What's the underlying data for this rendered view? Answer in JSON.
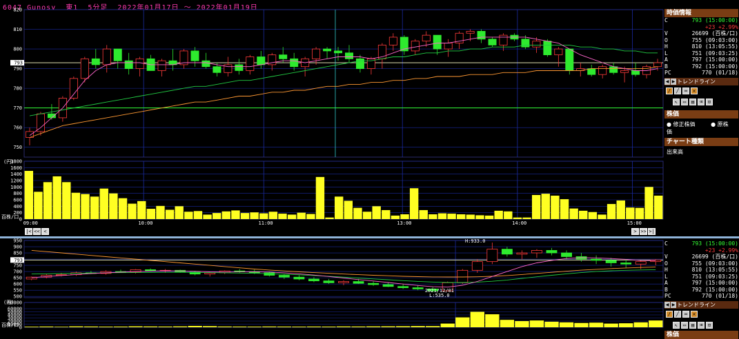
{
  "title": "6047 Gunosy  東1  5分足  2022年01月17日 ～ 2022年01月19日",
  "colors": {
    "up": "#ff3b3b",
    "down": "#2eea2e",
    "volume": "#ffff22",
    "grid": "#1a2aa0",
    "ma_fast": "#ff66cc",
    "ma_mid": "#22cc44",
    "ma_slow": "#ff9933"
  },
  "info": {
    "header": "時価情報",
    "rows": [
      {
        "k": "C",
        "v": "793 (15:00:00)",
        "cls": "green"
      },
      {
        "k": "",
        "v": "+23 +2.99%",
        "cls": "red"
      },
      {
        "k": "V",
        "v": "26699 (百株/口)",
        "cls": ""
      },
      {
        "k": "O",
        "v": "755 (09:03:00)",
        "cls": ""
      },
      {
        "k": "H",
        "v": "810 (13:05:55)",
        "cls": ""
      },
      {
        "k": "L",
        "v": "751 (09:03:25)",
        "cls": ""
      },
      {
        "k": "A",
        "v": "797 (15:00:00)",
        "cls": ""
      },
      {
        "k": "B",
        "v": "792 (15:00:00)",
        "cls": ""
      },
      {
        "k": "PC",
        "v": "770 (01/18)",
        "cls": ""
      }
    ],
    "trendline_label": "トレンドライン",
    "price_header": "株価",
    "radio_adjusted": "修正株価",
    "radio_original": "原株価",
    "chart_type_header": "チャート種類",
    "chart_type_value": "出来高",
    "bottom_header": "株価"
  },
  "chart_data": [
    {
      "type": "candlestick",
      "title": "6047 Gunosy  東1  5分足  2022年01月17日 ～ 2022年01月19日",
      "ylabel": "(円)",
      "yticks": [
        750,
        760,
        770,
        780,
        790,
        800,
        810,
        820
      ],
      "ylim": [
        745,
        820
      ],
      "current_price": 793,
      "prev_close": 770,
      "x_ticks": [
        "09:00",
        "10:00",
        "11:00",
        "13:00",
        "14:00",
        "15:00"
      ],
      "candles": [
        [
          755,
          760,
          751,
          758
        ],
        [
          758,
          768,
          756,
          767
        ],
        [
          767,
          772,
          764,
          765
        ],
        [
          765,
          776,
          763,
          775
        ],
        [
          775,
          786,
          774,
          785
        ],
        [
          785,
          796,
          783,
          795
        ],
        [
          795,
          800,
          790,
          792
        ],
        [
          792,
          802,
          788,
          800
        ],
        [
          800,
          798,
          790,
          794
        ],
        [
          794,
          798,
          787,
          790
        ],
        [
          790,
          796,
          786,
          795
        ],
        [
          795,
          797,
          789,
          789
        ],
        [
          789,
          795,
          786,
          794
        ],
        [
          794,
          800,
          789,
          792
        ],
        [
          792,
          800,
          790,
          799
        ],
        [
          799,
          801,
          791,
          794
        ],
        [
          794,
          798,
          790,
          791
        ],
        [
          791,
          793,
          786,
          788
        ],
        [
          788,
          796,
          786,
          792
        ],
        [
          792,
          795,
          787,
          789
        ],
        [
          789,
          797,
          787,
          796
        ],
        [
          796,
          799,
          790,
          792
        ],
        [
          792,
          798,
          789,
          797
        ],
        [
          797,
          801,
          793,
          795
        ],
        [
          795,
          798,
          789,
          791
        ],
        [
          791,
          796,
          786,
          795
        ],
        [
          795,
          801,
          792,
          800
        ],
        [
          800,
          801,
          795,
          799
        ],
        [
          799,
          801,
          794,
          798
        ],
        [
          798,
          802,
          793,
          795
        ],
        [
          795,
          797,
          788,
          790
        ],
        [
          790,
          796,
          787,
          795
        ],
        [
          795,
          803,
          790,
          802
        ],
        [
          802,
          808,
          799,
          806
        ],
        [
          806,
          807,
          797,
          799
        ],
        [
          799,
          805,
          797,
          804
        ],
        [
          804,
          809,
          801,
          807
        ],
        [
          807,
          806,
          797,
          800
        ],
        [
          800,
          805,
          796,
          803
        ],
        [
          803,
          809,
          800,
          808
        ],
        [
          808,
          810,
          804,
          809
        ],
        [
          809,
          810,
          803,
          805
        ],
        [
          805,
          806,
          801,
          802
        ],
        [
          802,
          808,
          799,
          807
        ],
        [
          807,
          808,
          804,
          805
        ],
        [
          805,
          807,
          800,
          801
        ],
        [
          801,
          806,
          798,
          804
        ],
        [
          804,
          805,
          796,
          797
        ],
        [
          797,
          801,
          791,
          800
        ],
        [
          800,
          800,
          787,
          789
        ],
        [
          789,
          793,
          786,
          790
        ],
        [
          790,
          792,
          786,
          787
        ],
        [
          787,
          792,
          785,
          791
        ],
        [
          791,
          793,
          787,
          788
        ],
        [
          788,
          791,
          783,
          789
        ],
        [
          789,
          793,
          786,
          787
        ],
        [
          787,
          792,
          785,
          791
        ],
        [
          791,
          795,
          789,
          793
        ]
      ],
      "ma_fast": [
        756,
        760,
        765,
        770,
        777,
        784,
        789,
        792,
        793,
        793,
        793,
        792,
        792,
        792,
        793,
        793,
        793,
        792,
        791,
        791,
        791,
        792,
        793,
        794,
        794,
        793,
        794,
        795,
        796,
        796,
        796,
        795,
        796,
        798,
        800,
        801,
        802,
        803,
        803,
        804,
        805,
        806,
        806,
        806,
        806,
        806,
        805,
        804,
        803,
        800,
        797,
        795,
        793,
        791,
        790,
        789,
        789,
        790
      ],
      "ma_mid": [
        766,
        767,
        768,
        769,
        770,
        771,
        772,
        773,
        774,
        775,
        776,
        777,
        778,
        779,
        780,
        781,
        781,
        782,
        783,
        784,
        784,
        785,
        786,
        787,
        788,
        789,
        790,
        791,
        792,
        793,
        794,
        794,
        795,
        796,
        796,
        797,
        798,
        798,
        799,
        799,
        800,
        800,
        801,
        801,
        801,
        802,
        802,
        802,
        802,
        802,
        801,
        801,
        800,
        800,
        799,
        799,
        798,
        798
      ],
      "ma_slow": [
        755,
        757,
        759,
        761,
        762,
        763,
        764,
        765,
        766,
        767,
        768,
        769,
        770,
        771,
        772,
        773,
        773,
        774,
        775,
        776,
        776,
        777,
        778,
        778,
        779,
        779,
        780,
        781,
        781,
        782,
        782,
        783,
        783,
        784,
        784,
        785,
        785,
        786,
        786,
        786,
        787,
        787,
        787,
        788,
        788,
        788,
        789,
        789,
        789,
        789,
        789,
        790,
        790,
        790,
        790,
        790,
        790,
        791
      ]
    },
    {
      "type": "bar",
      "ylabel": "百株/口",
      "yticks": [
        0,
        200,
        400,
        600,
        800,
        1000,
        1200,
        1400,
        1600,
        1800
      ],
      "ylim": [
        0,
        1800
      ],
      "values": [
        1500,
        850,
        1150,
        1330,
        1150,
        820,
        780,
        700,
        950,
        800,
        650,
        480,
        560,
        320,
        410,
        290,
        400,
        230,
        250,
        140,
        190,
        240,
        270,
        190,
        210,
        180,
        230,
        170,
        140,
        200,
        160,
        1310,
        50,
        700,
        570,
        350,
        230,
        400,
        280,
        110,
        150,
        960,
        280,
        150,
        180,
        170,
        150,
        140,
        120,
        110,
        260,
        240,
        50,
        50,
        750,
        790,
        730,
        620,
        330,
        260,
        220,
        140,
        470,
        580,
        360,
        350,
        1000,
        730
      ]
    },
    {
      "type": "candlestick",
      "ylabel": "(円)",
      "yticks": [
        500,
        550,
        600,
        650,
        700,
        750,
        800,
        850,
        900,
        950
      ],
      "ylim": [
        490,
        950
      ],
      "annotations": {
        "high": "H:933.0",
        "low_date": "2021/12/01",
        "low": "L:535.0"
      },
      "current_price": 793,
      "candles": [
        [
          640,
          660,
          630,
          655
        ],
        [
          655,
          680,
          645,
          670
        ],
        [
          670,
          690,
          660,
          675
        ],
        [
          675,
          700,
          665,
          690
        ],
        [
          690,
          705,
          680,
          685
        ],
        [
          685,
          710,
          675,
          700
        ],
        [
          700,
          715,
          690,
          695
        ],
        [
          695,
          720,
          685,
          715
        ],
        [
          715,
          725,
          700,
          705
        ],
        [
          705,
          720,
          690,
          710
        ],
        [
          710,
          715,
          690,
          695
        ],
        [
          695,
          705,
          670,
          680
        ],
        [
          680,
          700,
          660,
          690
        ],
        [
          690,
          710,
          680,
          705
        ],
        [
          705,
          720,
          690,
          700
        ],
        [
          700,
          715,
          680,
          690
        ],
        [
          690,
          700,
          660,
          670
        ],
        [
          670,
          680,
          640,
          655
        ],
        [
          655,
          670,
          630,
          640
        ],
        [
          640,
          655,
          615,
          625
        ],
        [
          625,
          640,
          600,
          610
        ],
        [
          610,
          630,
          590,
          620
        ],
        [
          620,
          640,
          600,
          605
        ],
        [
          605,
          620,
          585,
          595
        ],
        [
          595,
          615,
          575,
          580
        ],
        [
          580,
          600,
          560,
          570
        ],
        [
          570,
          590,
          550,
          560
        ],
        [
          560,
          575,
          535,
          545
        ],
        [
          545,
          620,
          540,
          610
        ],
        [
          610,
          720,
          600,
          710
        ],
        [
          710,
          800,
          690,
          780
        ],
        [
          780,
          933,
          760,
          880
        ],
        [
          880,
          900,
          820,
          840
        ],
        [
          840,
          870,
          800,
          850
        ],
        [
          850,
          880,
          810,
          870
        ],
        [
          870,
          890,
          830,
          850
        ],
        [
          850,
          870,
          800,
          820
        ],
        [
          820,
          850,
          780,
          800
        ],
        [
          800,
          830,
          760,
          790
        ],
        [
          790,
          810,
          740,
          770
        ],
        [
          770,
          800,
          730,
          760
        ],
        [
          760,
          790,
          720,
          780
        ],
        [
          780,
          800,
          750,
          793
        ]
      ],
      "ma_fast": [
        650,
        660,
        668,
        676,
        684,
        690,
        695,
        700,
        704,
        706,
        705,
        702,
        698,
        696,
        697,
        698,
        696,
        690,
        682,
        672,
        660,
        648,
        635,
        624,
        612,
        600,
        588,
        578,
        575,
        590,
        620,
        660,
        700,
        740,
        770,
        790,
        805,
        812,
        810,
        805,
        798,
        790,
        788
      ],
      "ma_mid": [
        680,
        682,
        684,
        686,
        688,
        690,
        691,
        692,
        693,
        694,
        694,
        693,
        692,
        690,
        688,
        686,
        683,
        679,
        674,
        668,
        662,
        655,
        648,
        641,
        634,
        627,
        621,
        616,
        612,
        612,
        615,
        622,
        632,
        645,
        658,
        670,
        682,
        692,
        700,
        706,
        710,
        713,
        715
      ],
      "ma_slow": [
        870,
        860,
        850,
        840,
        830,
        820,
        810,
        800,
        790,
        780,
        770,
        760,
        750,
        740,
        730,
        720,
        712,
        705,
        698,
        692,
        686,
        680,
        675,
        670,
        666,
        662,
        659,
        657,
        656,
        656,
        658,
        662,
        668,
        676,
        685,
        694,
        703,
        711,
        718,
        724,
        729,
        733,
        736
      ]
    },
    {
      "type": "bar",
      "ylabel": "百株/口",
      "yticks": [
        0,
        10000,
        20000,
        30000,
        40000,
        50000,
        60000,
        80000
      ],
      "ylim": [
        0,
        80000
      ],
      "values": [
        2000,
        2500,
        1800,
        3000,
        2600,
        2200,
        2400,
        3200,
        2800,
        2500,
        3000,
        4500,
        3800,
        2600,
        2400,
        2200,
        2600,
        2400,
        2200,
        2500,
        2300,
        2800,
        2600,
        3000,
        3200,
        3500,
        4000,
        3800,
        12000,
        32000,
        50000,
        42000,
        24000,
        20000,
        22000,
        18000,
        16000,
        14000,
        15000,
        12000,
        13000,
        16000,
        22000
      ]
    }
  ],
  "nav": {
    "first": "|<",
    "prev_page": "<<",
    "prev": "<",
    "next": ">",
    "next_page": ">>",
    "last": ">|"
  }
}
